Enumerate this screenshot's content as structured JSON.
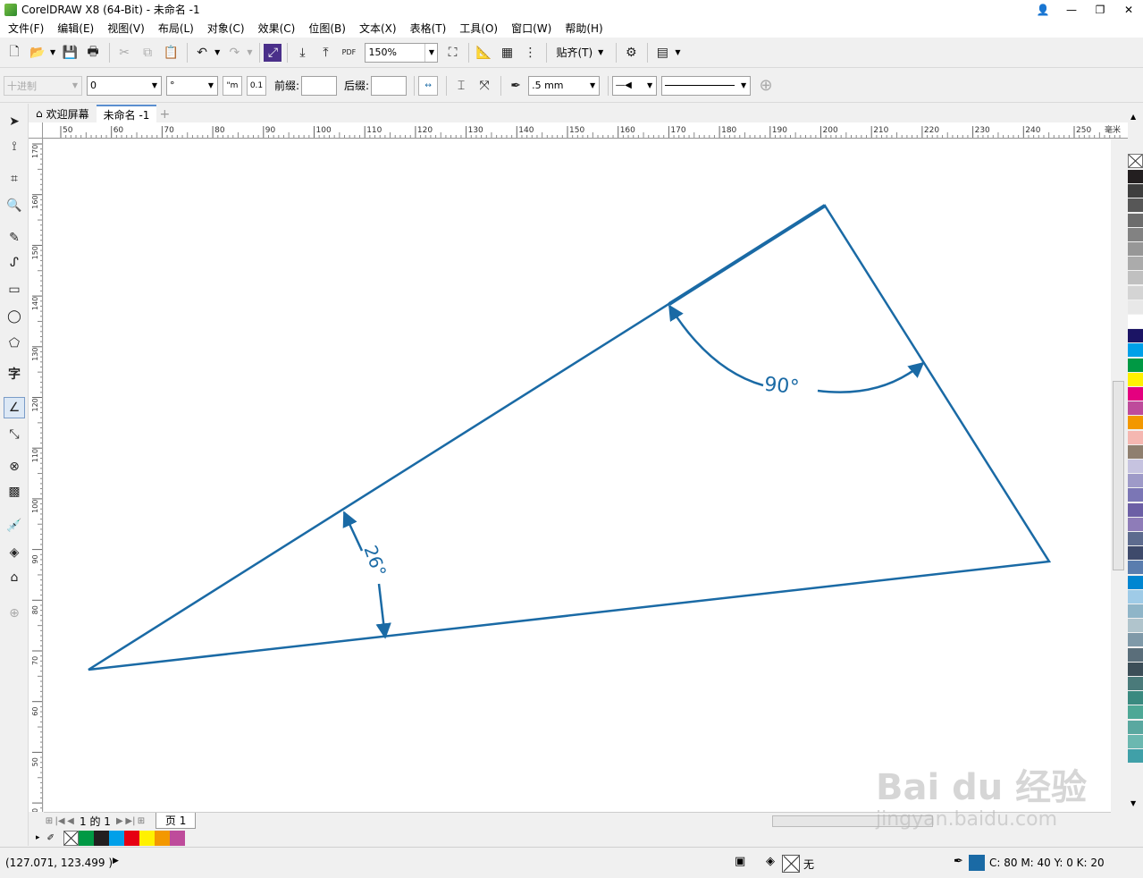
{
  "window": {
    "title": "CorelDRAW X8 (64-Bit) - 未命名 -1",
    "controls": [
      "👤",
      "—",
      "❐",
      "✕"
    ]
  },
  "menu": [
    "文件(F)",
    "编辑(E)",
    "视图(V)",
    "布局(L)",
    "对象(C)",
    "效果(C)",
    "位图(B)",
    "文本(X)",
    "表格(T)",
    "工具(O)",
    "窗口(W)",
    "帮助(H)"
  ],
  "standard_toolbar": {
    "zoom_value": "150%",
    "snap_label": "贴齐(T)",
    "pdf_label": "PDF"
  },
  "property_bar": {
    "style_value": "十进制",
    "precision_value": "0",
    "unit_value": "°",
    "prefix_label": "前缀:",
    "suffix_label": "后缀:",
    "outline_width": ".5 mm"
  },
  "doc_tabs": {
    "welcome": "欢迎屏幕",
    "active": "未命名 -1"
  },
  "rulers": {
    "h_ticks": [
      "50",
      "60",
      "70",
      "80",
      "90",
      "100",
      "110",
      "120",
      "130",
      "140",
      "150",
      "160",
      "170",
      "180",
      "190",
      "200",
      "210",
      "220",
      "230",
      "240",
      "250"
    ],
    "h_unit": "毫米",
    "v_ticks": [
      "170",
      "160",
      "150",
      "140",
      "130",
      "120",
      "110",
      "100",
      "90",
      "80",
      "70",
      "60",
      "50",
      "40"
    ]
  },
  "drawing": {
    "angle_large": "90°",
    "angle_small": "26°",
    "stroke_color": "#1a6aa5"
  },
  "page_nav": {
    "page_count": "1 的 1",
    "page_tab": "页 1"
  },
  "palette_colors": [
    "#231f20",
    "#3e3e3e",
    "#575757",
    "#6d6d6d",
    "#828282",
    "#979797",
    "#ababab",
    "#c0c0c0",
    "#d4d4d4",
    "#e8e8e8",
    "#ffffff",
    "#1b1464",
    "#00a0e9",
    "#009944",
    "#fff100",
    "#e4007f",
    "#be4b9b",
    "#f39800",
    "#f5b7b1",
    "#8f7f6f",
    "#c6c3e0",
    "#9e9ac8",
    "#7b76b5",
    "#6c5fa5",
    "#8e7cb8",
    "#5d6b8e",
    "#3e4a6b",
    "#5a7dae",
    "#0086d1",
    "#9fcbe7",
    "#8fb5c8",
    "#b0c4cc",
    "#7f99a8",
    "#5a6e7a",
    "#3c4e58",
    "#4a7a7a",
    "#3a8a80",
    "#4ea896",
    "#5aa8a0",
    "#6bb8b0",
    "#40a0a8"
  ],
  "doc_palette": [
    "#009944",
    "#231f20",
    "#00a0e9",
    "#e60012",
    "#fff100",
    "#f39800",
    "#be4b9b"
  ],
  "status": {
    "coords": "(127.071, 123.499 )",
    "fill_label": "无",
    "outline_text": "C: 80 M: 40 Y: 0 K: 20",
    "outline_color": "#1a6aa5"
  },
  "watermark": {
    "line1": "Bai du 经验",
    "line2": "jingyan.baidu.com"
  }
}
